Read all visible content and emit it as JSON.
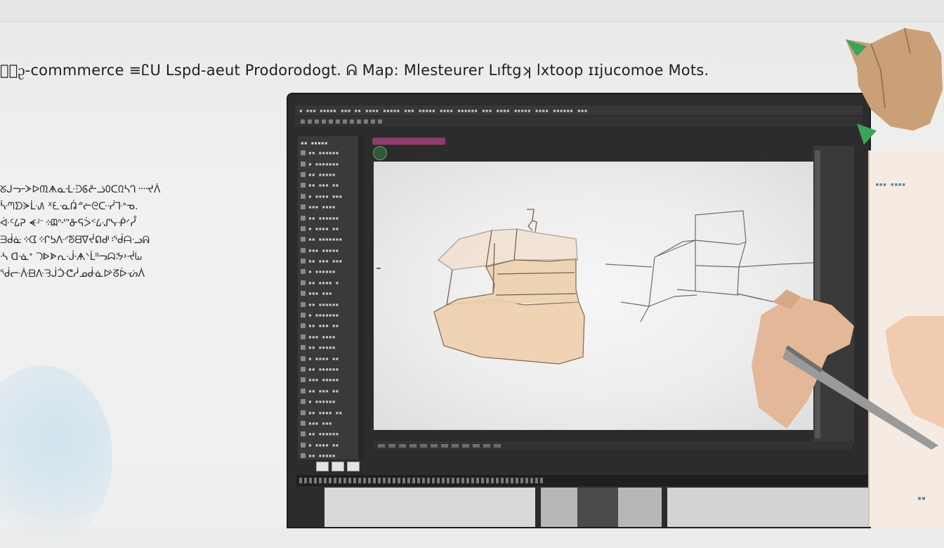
{
  "headline": "ᛰ᷃ᦳ-commmerce ≡᜻Ꮭᑌ ᒪspd-aeut Prodorodogt. ᕱ Map: Mlesteurer Lıftgʞ lxtoop ɪɪjucomoe Mots.",
  "side_text": {
    "lines": [
      "ᘜᒍᓓ᠆ᗆᐅ᠓ᗗᓇ᠊ᒷᑓ᠖ᓔᓘ᠐ᑕ᠒ᓴᒉ᠁ᔪᐲ",
      "ᔃᘉᗤᗔᒹ᠕ ᕽ᠎ᘍᓋ᠍ᕣᓒᓖᘓᑢ᠌ᓺᒭᐤᓀ.",
      "ᐚᑦ᠘ᕈ ᗛᒽᐨ᠅ᗼᐢ᠊ᔥᓁᕋᐴᑉ᠘ᔙᓷᑸᐟᓮ",
      "ᗳᑰᓎ᠅ᗧ᠅ᒋᕊ᠌ᐽᔇᘕᗺᐁᔫᕠᒇ᠄ᖂᗩᓢᕱ",
      "ᔀ ᗡ᠍ᓍᐩ ᘄᐈᗍᕆᒚ᠊ᗗᐠᒫᐦᓓᗣᔽ᠈ᔷᘈ",
      "ᖂᓟᐿᗹᐽᘌᒎᑠᕦᓲᓄᑽᓈᐭᘔᐆᔣᐲ"
    ]
  },
  "editor": {
    "menu_items": [
      "▪ ▪▪▪ ▪▪▪▪▪",
      "▪▪▪ ▪▪",
      "▪▪▪▪",
      "▪▪▪▪▪",
      "▪▪▪",
      "▪▪▪▪▪",
      "▪▪▪▪",
      "▪▪▪▪▪▪",
      "▪▪▪",
      "▪▪▪▪",
      "▪▪▪▪▪",
      "▪▪▪▪",
      "▪▪▪▪▪▪",
      "▪▪▪"
    ],
    "panel_title": "▪▪ ▪▪▪▪▪",
    "tools": [
      "▪▪ ▪▪▪▪▪▪",
      "▪ ▪▪▪▪▪▪▪",
      "▪▪ ▪▪▪▪▪",
      "▪▪ ▪▪▪ ▪▪",
      "▪ ▪▪▪▪ ▪▪▪",
      "▪▪▪ ▪▪▪▪",
      "▪▪ ▪▪▪▪▪▪",
      "▪ ▪▪▪▪ ▪▪",
      "▪▪ ▪▪▪▪▪▪▪",
      "▪▪▪ ▪▪▪▪▪",
      "▪▪ ▪▪▪ ▪▪▪",
      "▪ ▪▪▪▪▪▪",
      "▪▪ ▪▪▪▪ ▪",
      "▪▪▪ ▪▪▪",
      "▪▪ ▪▪▪▪▪▪",
      "▪ ▪▪▪▪▪▪▪",
      "▪▪ ▪▪▪ ▪▪",
      "▪▪▪ ▪▪▪▪",
      "▪▪ ▪▪▪▪▪",
      "▪ ▪▪▪▪ ▪▪",
      "▪▪ ▪▪▪▪▪▪",
      "▪▪▪ ▪▪▪▪▪",
      "▪▪ ▪▪▪ ▪▪",
      "▪ ▪▪▪▪▪▪",
      "▪▪ ▪▪▪▪ ▪▪",
      "▪▪▪ ▪▪▪",
      "▪▪ ▪▪▪▪▪▪",
      "▪ ▪▪▪▪ ▪▪",
      "▪▪ ▪▪▪▪▪"
    ]
  },
  "right_doc": {
    "dots": "▪▪▪ ▪▪▪▪",
    "mark": "▪▪"
  },
  "colors": {
    "doc_tab": "#8c3c6d",
    "badge": "#2e5a3a",
    "leaf": "#3aa55a",
    "skin": "#e3b898"
  },
  "icons": [
    "panel-tool-icon",
    "brush-icon",
    "stylus-icon",
    "hand-icon"
  ]
}
